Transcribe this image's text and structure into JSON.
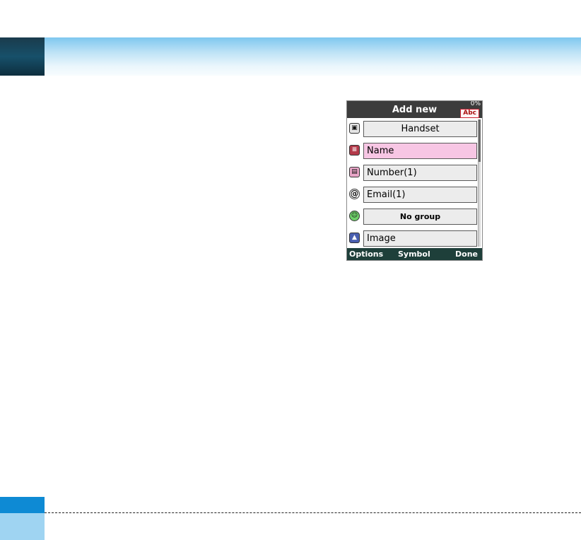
{
  "screen": {
    "title": "Add new",
    "battery": "0%",
    "input_mode": "Abc"
  },
  "fields": [
    {
      "label": "Handset",
      "icon": "handset-storage-icon"
    },
    {
      "label": "Name",
      "icon": "name-card-icon"
    },
    {
      "label": "Number(1)",
      "icon": "phone-number-icon"
    },
    {
      "label": "Email(1)",
      "icon": "email-at-icon"
    },
    {
      "label": "No group",
      "icon": "group-icon"
    },
    {
      "label": "Image",
      "icon": "image-icon"
    }
  ],
  "softkeys": {
    "left": "Options",
    "middle": "Symbol",
    "right": "Done"
  },
  "colors": {
    "selected_field": "#f7c6e4",
    "field_bg": "#ececec",
    "title_bar": "#3c3c3c",
    "softkey_bar": "#1e3f3a",
    "header_band": "#bfe3f6",
    "footer_blue": "#0e8ad4"
  }
}
